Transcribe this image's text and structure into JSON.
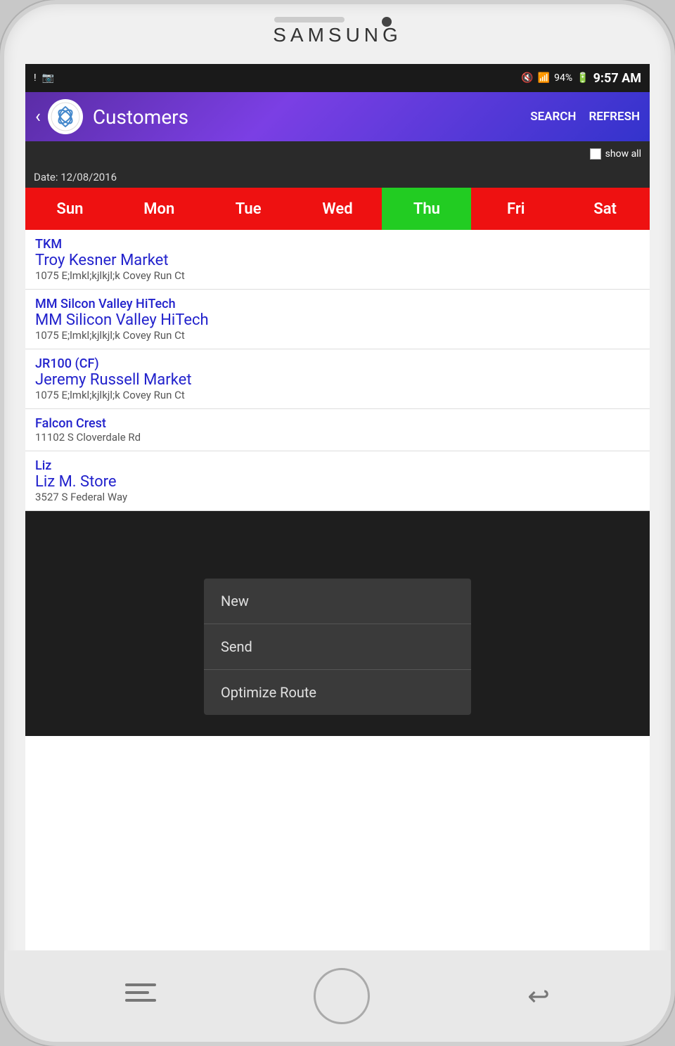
{
  "device": {
    "brand": "SAMSUNG"
  },
  "status_bar": {
    "time": "9:57 AM",
    "battery": "94%",
    "signal_icon": "📶",
    "wifi_icon": "📡",
    "notification_icon": "!"
  },
  "header": {
    "title": "Customers",
    "search_label": "SEARCH",
    "refresh_label": "REFRESH"
  },
  "filter": {
    "show_all_label": "show all",
    "date_label": "Date: 12/08/2016"
  },
  "days": [
    {
      "label": "Sun",
      "active": false
    },
    {
      "label": "Mon",
      "active": false
    },
    {
      "label": "Tue",
      "active": false
    },
    {
      "label": "Wed",
      "active": false
    },
    {
      "label": "Thu",
      "active": true
    },
    {
      "label": "Fri",
      "active": false
    },
    {
      "label": "Sat",
      "active": false
    }
  ],
  "customers": [
    {
      "code": "TKM",
      "name": "Troy Kesner Market",
      "address": "1075 E;lmkl;kjlkjl;k Covey Run Ct"
    },
    {
      "code": "MM Silcon Valley HiTech",
      "name": "MM Silicon Valley HiTech",
      "address": "1075 E;lmkl;kjlkjl;k Covey Run Ct"
    },
    {
      "code": "JR100 (CF)",
      "name": "Jeremy Russell Market",
      "address": "1075 E;lmkl;kjlkjl;k Covey Run Ct"
    },
    {
      "code": "Falcon Crest",
      "name": "",
      "address": "11102 S Cloverdale Rd"
    },
    {
      "code": "Liz",
      "name": "Liz M. Store",
      "address": "3527 S Federal Way"
    }
  ],
  "context_menu": {
    "items": [
      "New",
      "Send",
      "Optimize Route"
    ]
  }
}
